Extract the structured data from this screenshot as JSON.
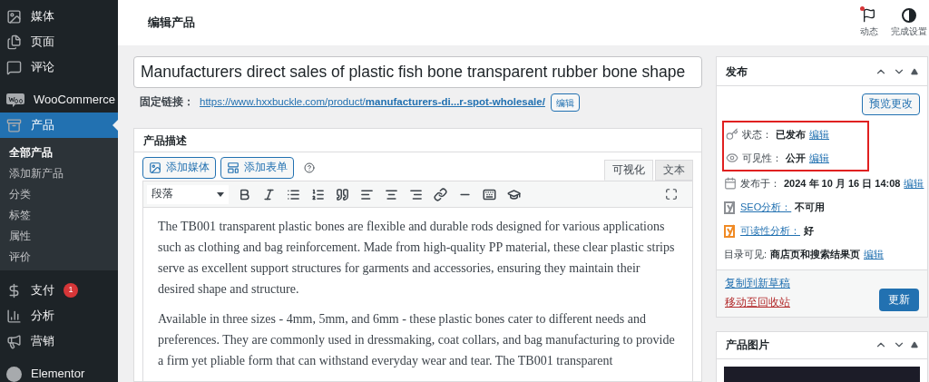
{
  "sidebar": {
    "items": [
      {
        "label": "媒体",
        "selected": false
      },
      {
        "label": "页面",
        "selected": false
      },
      {
        "label": "评论",
        "selected": false
      },
      {
        "label": "WooCommerce",
        "selected": false
      },
      {
        "label": "产品",
        "selected": true,
        "children": [
          {
            "label": "全部产品",
            "selected": true
          },
          {
            "label": "添加新产品",
            "selected": false
          },
          {
            "label": "分类",
            "selected": false
          },
          {
            "label": "标签",
            "selected": false
          },
          {
            "label": "属性",
            "selected": false
          },
          {
            "label": "评价",
            "selected": false
          }
        ]
      },
      {
        "label": "支付",
        "selected": false,
        "badge": "1"
      },
      {
        "label": "分析",
        "selected": false
      },
      {
        "label": "营销",
        "selected": false
      },
      {
        "label": "Elementor",
        "selected": false
      }
    ]
  },
  "header": {
    "title": "编辑产品",
    "actions": [
      {
        "label": "动态",
        "notification": true
      },
      {
        "label": "完成设置",
        "notification": false
      }
    ]
  },
  "editor": {
    "title_value": "Manufacturers direct sales of plastic fish bone transparent rubber bone shape",
    "permalink": {
      "label": "固定链接：",
      "base": "https://www.hxxbuckle.com/product/",
      "slug": "manufacturers-di...r-spot-wholesale/",
      "button": "编辑"
    },
    "description": {
      "heading": "产品描述",
      "buttons": [
        "添加媒体",
        "添加表单"
      ],
      "tabs": [
        {
          "label": "可视化",
          "selected": true
        },
        {
          "label": "文本",
          "selected": false
        }
      ],
      "format": "段落",
      "paragraphs": [
        "The TB001 transparent plastic bones are flexible and durable rods designed for various applications such as clothing and bag reinforcement. Made from high-quality PP material, these clear plastic strips serve as excellent support structures for garments and accessories, ensuring they maintain their desired shape and structure.",
        "Available in three sizes - 4mm, 5mm, and 6mm - these plastic bones cater to different needs and preferences. They are commonly used in dressmaking, coat collars, and bag manufacturing to provide a firm yet pliable form that can withstand everyday wear and tear. The TB001 transparent"
      ]
    }
  },
  "publish": {
    "title": "发布",
    "preview_button": "预览更改",
    "rows": [
      {
        "kind": "meta",
        "label": "状态：",
        "value": "已发布",
        "link": "编辑",
        "highlighted": true
      },
      {
        "kind": "meta",
        "label": "可见性：",
        "value": "公开",
        "link": "编辑",
        "highlighted": true
      },
      {
        "kind": "meta",
        "label": "发布于：",
        "value": "2024 年 10 月 16 日 14:08",
        "link": "编辑",
        "highlighted": false
      },
      {
        "kind": "analysis",
        "label": "SEO分析：",
        "value": "不可用",
        "color": "#8c8f94",
        "highlighted": false
      },
      {
        "kind": "analysis",
        "label": "可读性分析：",
        "value": "好",
        "color": "#f08a24",
        "highlighted": false
      },
      {
        "kind": "plain",
        "label": "目录可见:",
        "value": "商店页和搜索结果页",
        "link": "编辑",
        "highlighted": false
      }
    ],
    "copy_link": "复制到新草稿",
    "trash_link": "移动至回收站",
    "update_button": "更新"
  },
  "product_image": {
    "title": "产品图片"
  }
}
